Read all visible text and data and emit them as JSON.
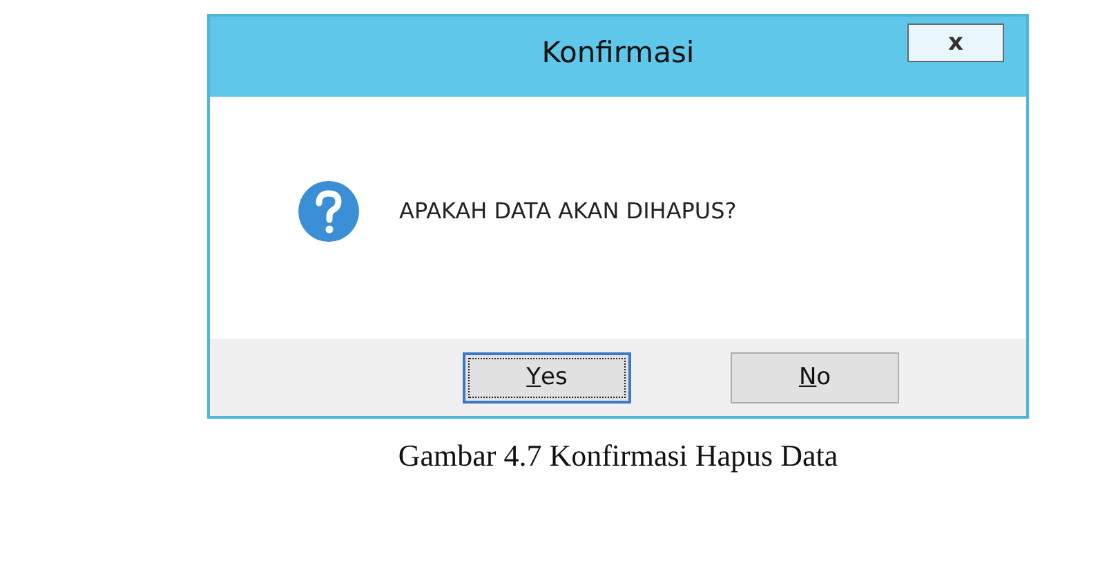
{
  "dialog": {
    "title": "Konfirmasi",
    "close_label": "x",
    "message": "APAKAH DATA AKAN DIHAPUS?",
    "buttons": [
      {
        "label": "Yes",
        "focused": true
      },
      {
        "label": "No",
        "focused": false
      }
    ]
  },
  "caption": "Gambar 4.7 Konfirmasi Hapus Data"
}
